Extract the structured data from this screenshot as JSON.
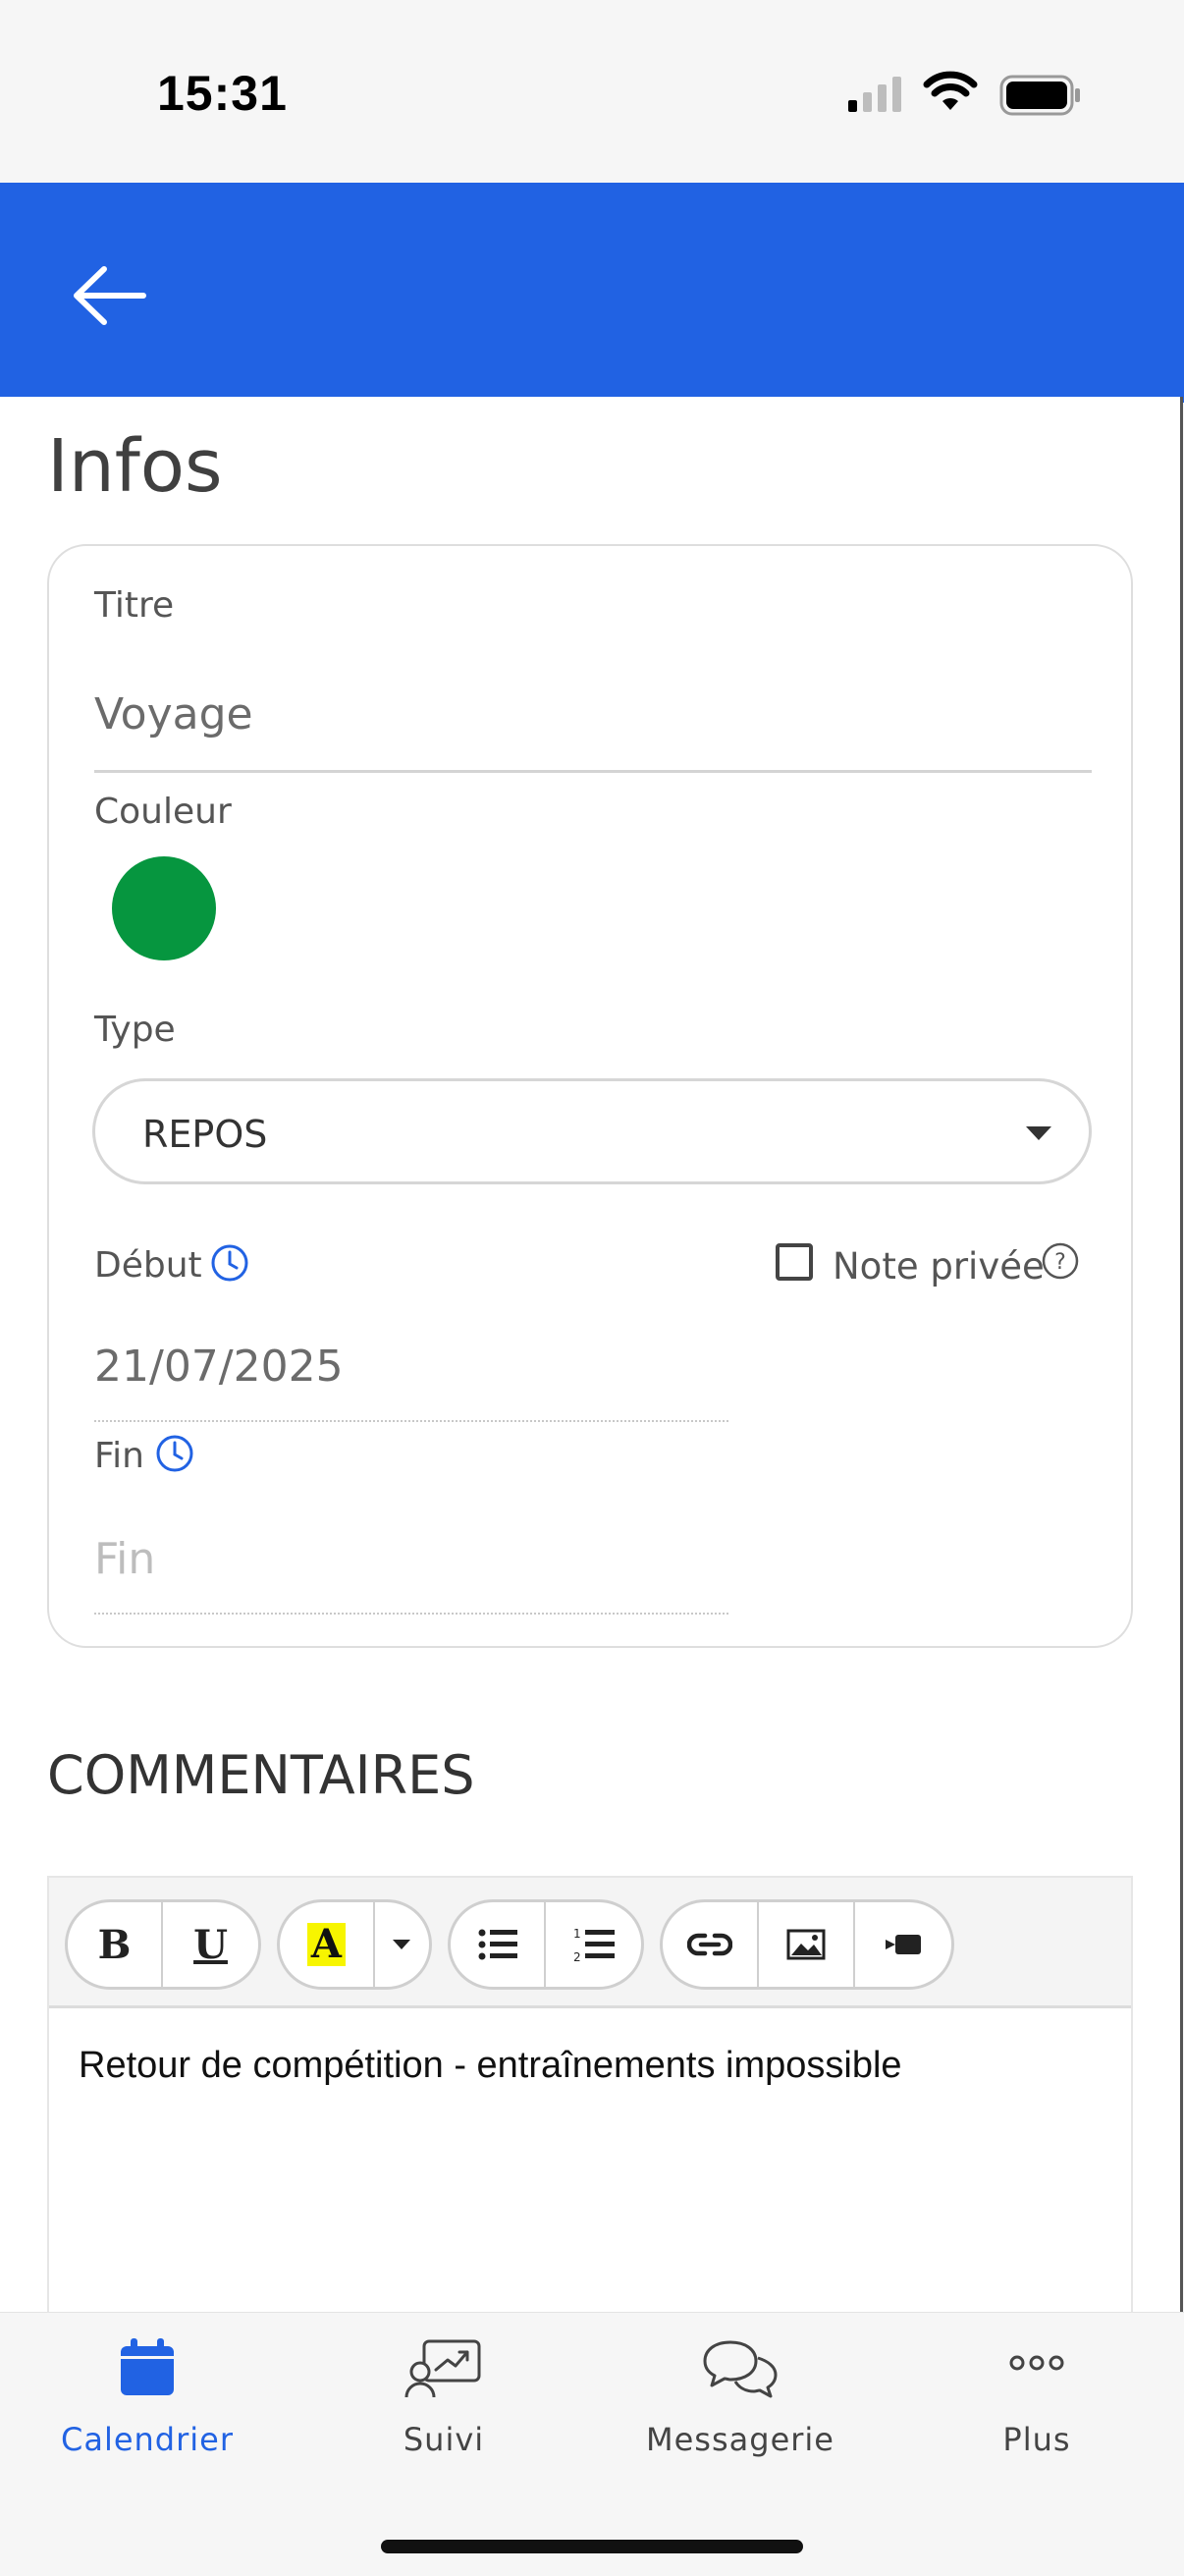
{
  "status": {
    "time": "15:31"
  },
  "page": {
    "title": "Infos"
  },
  "form": {
    "titre_label": "Titre",
    "titre_value": "Voyage",
    "couleur_label": "Couleur",
    "couleur_value": "#06963f",
    "type_label": "Type",
    "type_value": "REPOS",
    "debut_label": "Début",
    "debut_value": "21/07/2025",
    "note_privee_label": "Note privée",
    "fin_label": "Fin",
    "fin_placeholder": "Fin"
  },
  "comments": {
    "title": "COMMENTAIRES",
    "text": "Retour de compétition - entraînements impossible",
    "toolbar": [
      "bold-icon",
      "underline-icon",
      "highlight-icon",
      "dropdown-icon",
      "bullet-list-icon",
      "numbered-list-icon",
      "link-icon",
      "image-icon",
      "video-icon"
    ]
  },
  "nav": {
    "items": [
      {
        "label": "Calendrier",
        "icon": "calendar-icon",
        "active": true
      },
      {
        "label": "Suivi",
        "icon": "tracking-icon",
        "active": false
      },
      {
        "label": "Messagerie",
        "icon": "chat-icon",
        "active": false
      },
      {
        "label": "Plus",
        "icon": "more-icon",
        "active": false
      }
    ]
  },
  "colors": {
    "brand": "#2162e3",
    "selected_color": "#06963f"
  }
}
